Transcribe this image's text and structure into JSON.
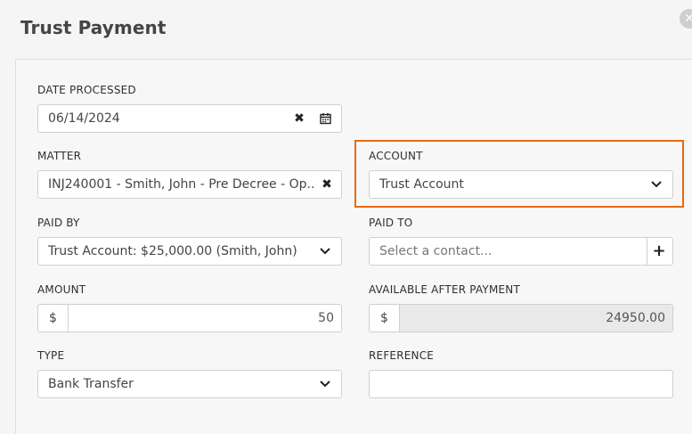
{
  "modal": {
    "title": "Trust Payment",
    "close_glyph": "✕"
  },
  "form": {
    "date_processed": {
      "label": "DATE PROCESSED",
      "value": "06/14/2024"
    },
    "matter": {
      "label": "MATTER",
      "value": "INJ240001 - Smith, John - Pre Decree - Op..."
    },
    "account": {
      "label": "ACCOUNT",
      "value": "Trust Account"
    },
    "paid_by": {
      "label": "PAID BY",
      "value": "Trust Account: $25,000.00 (Smith, John)"
    },
    "paid_to": {
      "label": "PAID TO",
      "placeholder": "Select a contact..."
    },
    "amount": {
      "label": "AMOUNT",
      "currency": "$",
      "value": "50"
    },
    "available_after_payment": {
      "label": "AVAILABLE AFTER PAYMENT",
      "currency": "$",
      "value": "24950.00"
    },
    "type": {
      "label": "TYPE",
      "value": "Bank Transfer"
    },
    "reference": {
      "label": "REFERENCE",
      "value": ""
    }
  },
  "icons": {
    "clear": "✖",
    "calendar": "calendar-icon",
    "chevron": "chevron-down-icon",
    "add": "+"
  },
  "colors": {
    "highlight": "#e56a12"
  }
}
